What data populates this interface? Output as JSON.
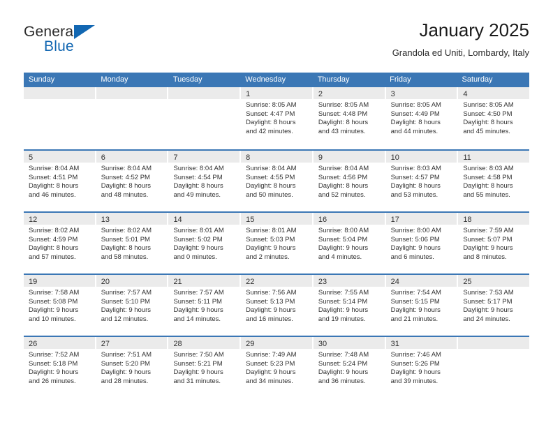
{
  "brand": {
    "name_top": "General",
    "name_bottom": "Blue",
    "triangle_color": "#1267b2",
    "top_color": "#2b2b2b"
  },
  "header": {
    "title": "January 2025",
    "subtitle": "Grandola ed Uniti, Lombardy, Italy"
  },
  "colors": {
    "header_band": "#3b77b5",
    "daynum_strip": "#ebebeb",
    "text": "#303030",
    "cell_background": "#ffffff"
  },
  "weekdays": [
    "Sunday",
    "Monday",
    "Tuesday",
    "Wednesday",
    "Thursday",
    "Friday",
    "Saturday"
  ],
  "weeks": [
    [
      {
        "day": "",
        "empty": true,
        "sunrise": "",
        "sunset": "",
        "daylight_1": "",
        "daylight_2": ""
      },
      {
        "day": "",
        "empty": true,
        "sunrise": "",
        "sunset": "",
        "daylight_1": "",
        "daylight_2": ""
      },
      {
        "day": "",
        "empty": true,
        "sunrise": "",
        "sunset": "",
        "daylight_1": "",
        "daylight_2": ""
      },
      {
        "day": "1",
        "empty": false,
        "sunrise": "Sunrise: 8:05 AM",
        "sunset": "Sunset: 4:47 PM",
        "daylight_1": "Daylight: 8 hours",
        "daylight_2": "and 42 minutes."
      },
      {
        "day": "2",
        "empty": false,
        "sunrise": "Sunrise: 8:05 AM",
        "sunset": "Sunset: 4:48 PM",
        "daylight_1": "Daylight: 8 hours",
        "daylight_2": "and 43 minutes."
      },
      {
        "day": "3",
        "empty": false,
        "sunrise": "Sunrise: 8:05 AM",
        "sunset": "Sunset: 4:49 PM",
        "daylight_1": "Daylight: 8 hours",
        "daylight_2": "and 44 minutes."
      },
      {
        "day": "4",
        "empty": false,
        "sunrise": "Sunrise: 8:05 AM",
        "sunset": "Sunset: 4:50 PM",
        "daylight_1": "Daylight: 8 hours",
        "daylight_2": "and 45 minutes."
      }
    ],
    [
      {
        "day": "5",
        "empty": false,
        "sunrise": "Sunrise: 8:04 AM",
        "sunset": "Sunset: 4:51 PM",
        "daylight_1": "Daylight: 8 hours",
        "daylight_2": "and 46 minutes."
      },
      {
        "day": "6",
        "empty": false,
        "sunrise": "Sunrise: 8:04 AM",
        "sunset": "Sunset: 4:52 PM",
        "daylight_1": "Daylight: 8 hours",
        "daylight_2": "and 48 minutes."
      },
      {
        "day": "7",
        "empty": false,
        "sunrise": "Sunrise: 8:04 AM",
        "sunset": "Sunset: 4:54 PM",
        "daylight_1": "Daylight: 8 hours",
        "daylight_2": "and 49 minutes."
      },
      {
        "day": "8",
        "empty": false,
        "sunrise": "Sunrise: 8:04 AM",
        "sunset": "Sunset: 4:55 PM",
        "daylight_1": "Daylight: 8 hours",
        "daylight_2": "and 50 minutes."
      },
      {
        "day": "9",
        "empty": false,
        "sunrise": "Sunrise: 8:04 AM",
        "sunset": "Sunset: 4:56 PM",
        "daylight_1": "Daylight: 8 hours",
        "daylight_2": "and 52 minutes."
      },
      {
        "day": "10",
        "empty": false,
        "sunrise": "Sunrise: 8:03 AM",
        "sunset": "Sunset: 4:57 PM",
        "daylight_1": "Daylight: 8 hours",
        "daylight_2": "and 53 minutes."
      },
      {
        "day": "11",
        "empty": false,
        "sunrise": "Sunrise: 8:03 AM",
        "sunset": "Sunset: 4:58 PM",
        "daylight_1": "Daylight: 8 hours",
        "daylight_2": "and 55 minutes."
      }
    ],
    [
      {
        "day": "12",
        "empty": false,
        "sunrise": "Sunrise: 8:02 AM",
        "sunset": "Sunset: 4:59 PM",
        "daylight_1": "Daylight: 8 hours",
        "daylight_2": "and 57 minutes."
      },
      {
        "day": "13",
        "empty": false,
        "sunrise": "Sunrise: 8:02 AM",
        "sunset": "Sunset: 5:01 PM",
        "daylight_1": "Daylight: 8 hours",
        "daylight_2": "and 58 minutes."
      },
      {
        "day": "14",
        "empty": false,
        "sunrise": "Sunrise: 8:01 AM",
        "sunset": "Sunset: 5:02 PM",
        "daylight_1": "Daylight: 9 hours",
        "daylight_2": "and 0 minutes."
      },
      {
        "day": "15",
        "empty": false,
        "sunrise": "Sunrise: 8:01 AM",
        "sunset": "Sunset: 5:03 PM",
        "daylight_1": "Daylight: 9 hours",
        "daylight_2": "and 2 minutes."
      },
      {
        "day": "16",
        "empty": false,
        "sunrise": "Sunrise: 8:00 AM",
        "sunset": "Sunset: 5:04 PM",
        "daylight_1": "Daylight: 9 hours",
        "daylight_2": "and 4 minutes."
      },
      {
        "day": "17",
        "empty": false,
        "sunrise": "Sunrise: 8:00 AM",
        "sunset": "Sunset: 5:06 PM",
        "daylight_1": "Daylight: 9 hours",
        "daylight_2": "and 6 minutes."
      },
      {
        "day": "18",
        "empty": false,
        "sunrise": "Sunrise: 7:59 AM",
        "sunset": "Sunset: 5:07 PM",
        "daylight_1": "Daylight: 9 hours",
        "daylight_2": "and 8 minutes."
      }
    ],
    [
      {
        "day": "19",
        "empty": false,
        "sunrise": "Sunrise: 7:58 AM",
        "sunset": "Sunset: 5:08 PM",
        "daylight_1": "Daylight: 9 hours",
        "daylight_2": "and 10 minutes."
      },
      {
        "day": "20",
        "empty": false,
        "sunrise": "Sunrise: 7:57 AM",
        "sunset": "Sunset: 5:10 PM",
        "daylight_1": "Daylight: 9 hours",
        "daylight_2": "and 12 minutes."
      },
      {
        "day": "21",
        "empty": false,
        "sunrise": "Sunrise: 7:57 AM",
        "sunset": "Sunset: 5:11 PM",
        "daylight_1": "Daylight: 9 hours",
        "daylight_2": "and 14 minutes."
      },
      {
        "day": "22",
        "empty": false,
        "sunrise": "Sunrise: 7:56 AM",
        "sunset": "Sunset: 5:13 PM",
        "daylight_1": "Daylight: 9 hours",
        "daylight_2": "and 16 minutes."
      },
      {
        "day": "23",
        "empty": false,
        "sunrise": "Sunrise: 7:55 AM",
        "sunset": "Sunset: 5:14 PM",
        "daylight_1": "Daylight: 9 hours",
        "daylight_2": "and 19 minutes."
      },
      {
        "day": "24",
        "empty": false,
        "sunrise": "Sunrise: 7:54 AM",
        "sunset": "Sunset: 5:15 PM",
        "daylight_1": "Daylight: 9 hours",
        "daylight_2": "and 21 minutes."
      },
      {
        "day": "25",
        "empty": false,
        "sunrise": "Sunrise: 7:53 AM",
        "sunset": "Sunset: 5:17 PM",
        "daylight_1": "Daylight: 9 hours",
        "daylight_2": "and 24 minutes."
      }
    ],
    [
      {
        "day": "26",
        "empty": false,
        "sunrise": "Sunrise: 7:52 AM",
        "sunset": "Sunset: 5:18 PM",
        "daylight_1": "Daylight: 9 hours",
        "daylight_2": "and 26 minutes."
      },
      {
        "day": "27",
        "empty": false,
        "sunrise": "Sunrise: 7:51 AM",
        "sunset": "Sunset: 5:20 PM",
        "daylight_1": "Daylight: 9 hours",
        "daylight_2": "and 28 minutes."
      },
      {
        "day": "28",
        "empty": false,
        "sunrise": "Sunrise: 7:50 AM",
        "sunset": "Sunset: 5:21 PM",
        "daylight_1": "Daylight: 9 hours",
        "daylight_2": "and 31 minutes."
      },
      {
        "day": "29",
        "empty": false,
        "sunrise": "Sunrise: 7:49 AM",
        "sunset": "Sunset: 5:23 PM",
        "daylight_1": "Daylight: 9 hours",
        "daylight_2": "and 34 minutes."
      },
      {
        "day": "30",
        "empty": false,
        "sunrise": "Sunrise: 7:48 AM",
        "sunset": "Sunset: 5:24 PM",
        "daylight_1": "Daylight: 9 hours",
        "daylight_2": "and 36 minutes."
      },
      {
        "day": "31",
        "empty": false,
        "sunrise": "Sunrise: 7:46 AM",
        "sunset": "Sunset: 5:26 PM",
        "daylight_1": "Daylight: 9 hours",
        "daylight_2": "and 39 minutes."
      },
      {
        "day": "",
        "empty": true,
        "sunrise": "",
        "sunset": "",
        "daylight_1": "",
        "daylight_2": ""
      }
    ]
  ]
}
